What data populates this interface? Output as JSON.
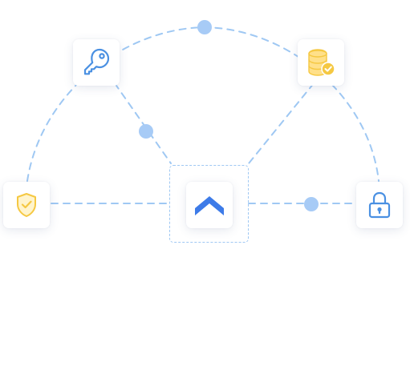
{
  "diagram": {
    "colors": {
      "connector": "#9fc8f3",
      "dot": "#a7cbf6",
      "key_icon": "#4a90e2",
      "lock_icon": "#4a90e2",
      "hub_icon": "#3d7be8",
      "database_icon": "#ffe08a",
      "database_badge": "#f5c842",
      "shield_icon": "#f5c842",
      "shield_fill": "#fff4cc"
    },
    "nodes": [
      {
        "id": "hub",
        "icon": "chevron-up-logo-icon"
      },
      {
        "id": "key",
        "icon": "key-icon"
      },
      {
        "id": "database",
        "icon": "database-check-icon"
      },
      {
        "id": "shield",
        "icon": "shield-check-icon"
      },
      {
        "id": "lock",
        "icon": "padlock-icon"
      }
    ]
  }
}
